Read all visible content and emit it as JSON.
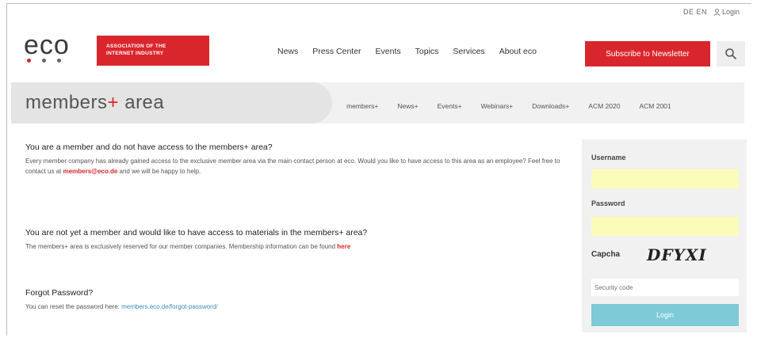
{
  "colors": {
    "brand_red": "#d9262c",
    "panel_bg": "#f1f1f1",
    "field_yellow": "#fcfcba",
    "login_teal": "#7ecad6",
    "link_blue": "#3a8fb7"
  },
  "utility": {
    "lang": "DE EN",
    "login": "Login"
  },
  "logo": {
    "word": "eco",
    "dots": [
      "#d9262c",
      "#666666",
      "#666666"
    ]
  },
  "association": {
    "line1": "ASSOCIATION OF THE",
    "line2": "INTERNET INDUSTRY"
  },
  "mainnav": [
    "News",
    "Press Center",
    "Events",
    "Topics",
    "Services",
    "About eco"
  ],
  "subscribe": "Subscribe to Newsletter",
  "members_title": {
    "text": "members",
    "plus": "+",
    "suffix": " area"
  },
  "subnav": [
    "members+",
    "News+",
    "Events+",
    "Webinars+",
    "Downloads+",
    "ACM 2020",
    "ACM 2001"
  ],
  "section1": {
    "heading": "You are a member and do not have access to the members+ area?",
    "text_a": "Every member company has already gained access to the exclusive member area via the main contact person at eco. Would you like to have access to this area as an employee? Feel free to contact us at ",
    "email": "members@eco.de",
    "text_b": " and we will be happy to help."
  },
  "section2": {
    "heading": "You are not yet a member and would like to have access to materials in the members+ area?",
    "text": "The members+ area is exclusively reserved for our member companies. Membership information can be found ",
    "link": "here"
  },
  "section3": {
    "heading": "Forgot Password?",
    "text": "You can reset the password here: ",
    "link": "members.eco.de/forgot-password/"
  },
  "login": {
    "username_label": "Username",
    "password_label": "Password",
    "captcha_label": "Capcha",
    "captcha_text": "DFYXI",
    "security_placeholder": "Security code",
    "button": "Login"
  }
}
